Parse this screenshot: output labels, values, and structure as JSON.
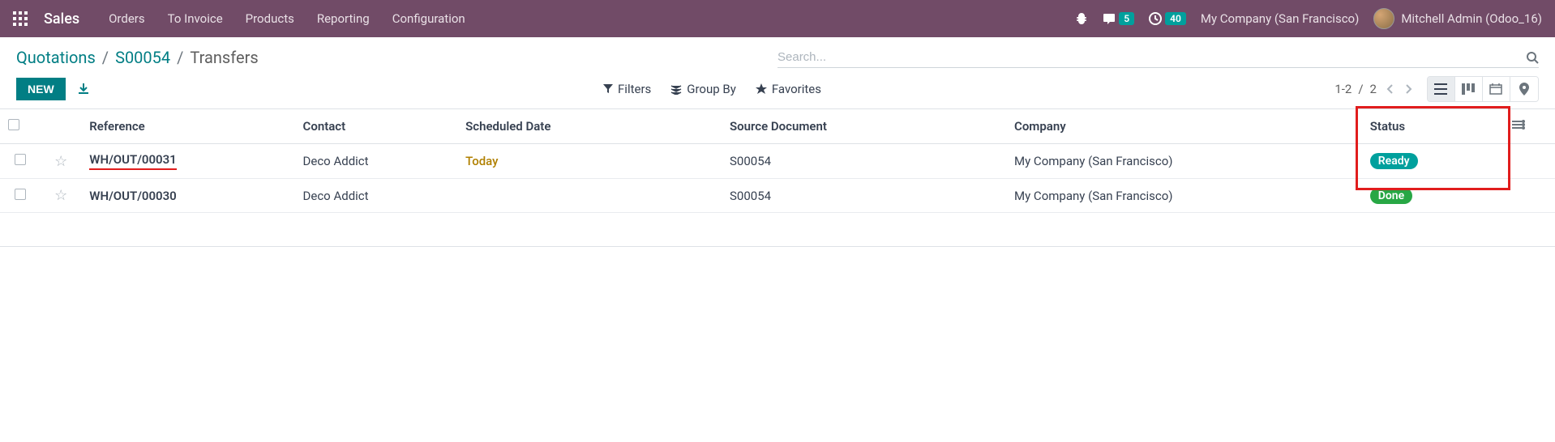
{
  "navbar": {
    "brand": "Sales",
    "menu": [
      "Orders",
      "To Invoice",
      "Products",
      "Reporting",
      "Configuration"
    ],
    "messages_count": "5",
    "activities_count": "40",
    "company": "My Company (San Francisco)",
    "user": "Mitchell Admin (Odoo_16)"
  },
  "breadcrumb": {
    "root": "Quotations",
    "mid": "S00054",
    "current": "Transfers"
  },
  "search": {
    "placeholder": "Search..."
  },
  "buttons": {
    "new": "NEW"
  },
  "toolbar": {
    "filters": "Filters",
    "groupby": "Group By",
    "favorites": "Favorites"
  },
  "pager": {
    "range": "1-2",
    "sep": "/",
    "total": "2"
  },
  "table": {
    "headers": {
      "reference": "Reference",
      "contact": "Contact",
      "scheduled": "Scheduled Date",
      "source": "Source Document",
      "company": "Company",
      "status": "Status"
    },
    "rows": [
      {
        "reference": "WH/OUT/00031",
        "ref_highlight": true,
        "contact": "Deco Addict",
        "scheduled": "Today",
        "scheduled_style": "today",
        "source": "S00054",
        "company": "My Company (San Francisco)",
        "status": "Ready",
        "status_style": "ready"
      },
      {
        "reference": "WH/OUT/00030",
        "ref_highlight": false,
        "contact": "Deco Addict",
        "scheduled": "",
        "scheduled_style": "",
        "source": "S00054",
        "company": "My Company (San Francisco)",
        "status": "Done",
        "status_style": "done"
      }
    ]
  }
}
